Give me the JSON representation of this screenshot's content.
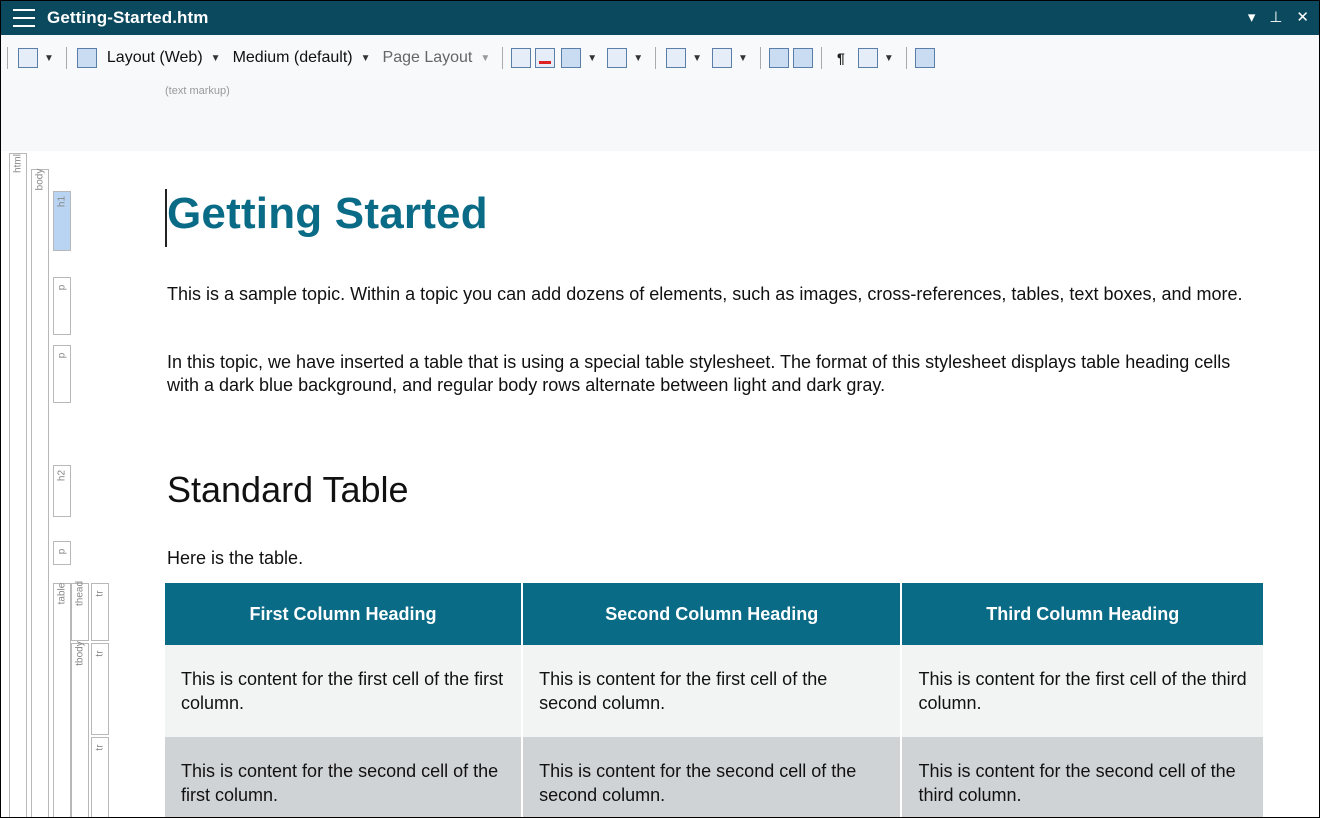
{
  "window": {
    "title": "Getting-Started.htm",
    "controls": [
      "▾",
      "⊥",
      "✕"
    ]
  },
  "toolbar": {
    "layout_label": "Layout (Web)",
    "medium_label": "Medium (default)",
    "page_layout_label": "Page Layout"
  },
  "markup_hint": "(text markup)",
  "structure": {
    "html": "html",
    "body": "body",
    "h1": "h1",
    "p1": "p",
    "p2": "p",
    "h2": "h2",
    "p3": "p",
    "table": "table",
    "thead": "thead",
    "tr1": "tr",
    "tbody": "tbody",
    "tr2": "tr",
    "tr3": "tr"
  },
  "document": {
    "heading": "Getting Started",
    "paragraph1": "This is a sample topic. Within a topic you can add dozens of elements, such as images, cross-references, tables, text boxes, and more.",
    "paragraph2": "In this topic, we have inserted a table that is using a special table stylesheet. The format of this stylesheet displays table heading cells with a dark blue background, and regular body rows alternate between light and dark gray.",
    "subheading": "Standard Table",
    "paragraph3": "Here is the table.",
    "table": {
      "headers": [
        "First Column Heading",
        "Second Column Heading",
        "Third Column Heading"
      ],
      "rows": [
        [
          "This is content for the first cell of the first column.",
          "This is content for the first cell of the second column.",
          "This is content for the first cell of the third column."
        ],
        [
          "This is content for the second cell of the first column.",
          "This is content for the second cell of the second column.",
          "This is content for the second cell of the third column."
        ]
      ]
    }
  },
  "colors": {
    "titlebar": "#0b4a5e",
    "heading": "#0a6b87",
    "table_header": "#0a6b87",
    "row_light": "#f2f3f3",
    "row_dark": "#d0d3d6"
  }
}
